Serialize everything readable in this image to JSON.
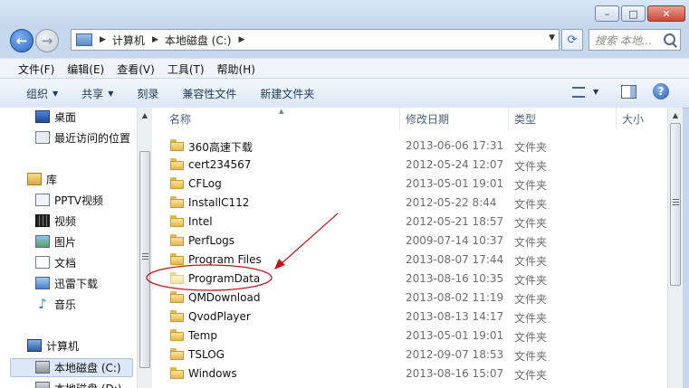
{
  "address": {
    "crumbs": [
      "计算机",
      "本地磁盘 (C:)"
    ]
  },
  "search": {
    "placeholder": "搜索 本地..."
  },
  "menu": [
    "文件(F)",
    "编辑(E)",
    "查看(V)",
    "工具(T)",
    "帮助(H)"
  ],
  "commands": {
    "organize": "组织",
    "share": "共享",
    "burn": "刻录",
    "compat": "兼容性文件",
    "newfolder": "新建文件夹"
  },
  "nav": {
    "desktop": "桌面",
    "recent": "最近访问的位置",
    "libraries": "库",
    "pptv": "PPTV视频",
    "video": "视频",
    "pictures": "图片",
    "documents": "文档",
    "xunlei": "迅雷下载",
    "music": "音乐",
    "computer": "计算机",
    "drive_c": "本地磁盘 (C:)",
    "drive_d": "本地磁盘 (D:)"
  },
  "columns": {
    "name": "名称",
    "date": "修改日期",
    "type": "类型",
    "size": "大小"
  },
  "files": [
    {
      "name": "360高速下载",
      "date": "2013-06-06 17:31",
      "type": "文件夹"
    },
    {
      "name": "cert234567",
      "date": "2012-05-24 12:07",
      "type": "文件夹"
    },
    {
      "name": "CFLog",
      "date": "2013-05-01 19:01",
      "type": "文件夹"
    },
    {
      "name": "InstallC112",
      "date": "2012-05-22 8:44",
      "type": "文件夹"
    },
    {
      "name": "Intel",
      "date": "2012-05-21 18:57",
      "type": "文件夹"
    },
    {
      "name": "PerfLogs",
      "date": "2009-07-14 10:37",
      "type": "文件夹"
    },
    {
      "name": "Program Files",
      "date": "2013-08-07 17:44",
      "type": "文件夹"
    },
    {
      "name": "ProgramData",
      "date": "2013-08-16 10:35",
      "type": "文件夹",
      "hidden": true
    },
    {
      "name": "QMDownload",
      "date": "2013-08-02 11:19",
      "type": "文件夹"
    },
    {
      "name": "QvodPlayer",
      "date": "2013-08-13 14:17",
      "type": "文件夹"
    },
    {
      "name": "Temp",
      "date": "2013-05-01 19:01",
      "type": "文件夹"
    },
    {
      "name": "TSLOG",
      "date": "2012-09-07 18:53",
      "type": "文件夹"
    },
    {
      "name": "Windows",
      "date": "2013-08-16 15:07",
      "type": "文件夹"
    }
  ],
  "colors": {
    "annotation": "#c0161b",
    "selected": "#dde8f6"
  }
}
